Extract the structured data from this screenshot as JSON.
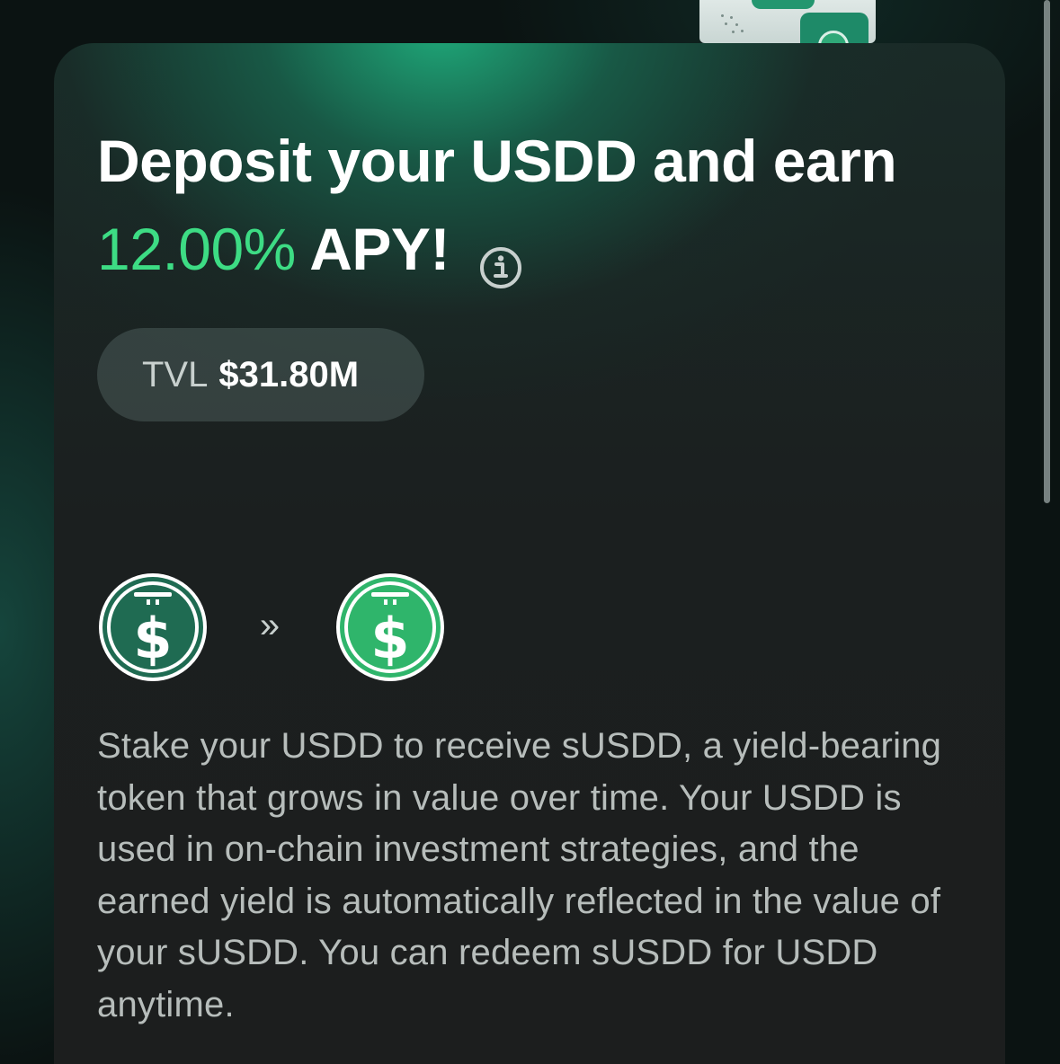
{
  "hero": {
    "title_line1": "Deposit your USDD and earn",
    "apy_value": "12.00%",
    "apy_label": "APY!",
    "info_icon": "info-icon"
  },
  "tvl": {
    "label": "TVL",
    "value": "$31.80M"
  },
  "conversion": {
    "from_token_icon": "usdd-token-icon",
    "arrow_icon": "double-chevron-right-icon",
    "arrow_glyph": "»",
    "to_token_icon": "susdd-token-icon"
  },
  "description": "Stake your USDD to receive sUSDD, a yield-bearing token that grows in value over time. Your USDD is used in on-chain investment strategies, and the earned yield is automatically reflected in the value of your sUSDD. You can redeem sUSDD for USDD anytime.",
  "colors": {
    "accent_green": "#3ddc84",
    "usdd_token": "#1f6b52",
    "susdd_token": "#2fb56b",
    "card_background": "#1c1e1e"
  }
}
